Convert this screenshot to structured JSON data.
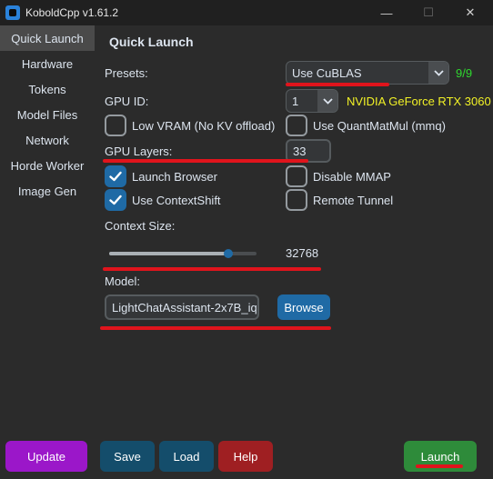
{
  "window": {
    "title": "KoboldCpp v1.61.2",
    "minimize": "—",
    "maximize": "☐",
    "close": "✕"
  },
  "sidebar": {
    "items": [
      {
        "label": "Quick Launch"
      },
      {
        "label": "Hardware"
      },
      {
        "label": "Tokens"
      },
      {
        "label": "Model Files"
      },
      {
        "label": "Network"
      },
      {
        "label": "Horde Worker"
      },
      {
        "label": "Image Gen"
      }
    ]
  },
  "main": {
    "title": "Quick Launch",
    "presets": {
      "label": "Presets:",
      "value": "Use CuBLAS",
      "count": "9/9"
    },
    "gpu_id": {
      "label": "GPU ID:",
      "value": "1",
      "gpu_name": "NVIDIA GeForce RTX 3060"
    },
    "options": {
      "low_vram": {
        "label": "Low VRAM (No KV offload)",
        "checked": false
      },
      "quantmatmul": {
        "label": "Use QuantMatMul (mmq)",
        "checked": false
      },
      "launch_browser": {
        "label": "Launch Browser",
        "checked": true
      },
      "disable_mmap": {
        "label": "Disable MMAP",
        "checked": false
      },
      "contextshift": {
        "label": "Use ContextShift",
        "checked": true
      },
      "remote_tunnel": {
        "label": "Remote Tunnel",
        "checked": false
      }
    },
    "gpu_layers": {
      "label": "GPU Layers:",
      "value": "33"
    },
    "context_size": {
      "label": "Context Size:",
      "value": "32768",
      "slider_fraction": 0.81
    },
    "model": {
      "label": "Model:",
      "value": "LightChatAssistant-2x7B_iq",
      "browse_label": "Browse"
    }
  },
  "footer": {
    "update_label": "Update",
    "save_label": "Save",
    "load_label": "Load",
    "help_label": "Help",
    "launch_label": "Launch"
  },
  "colors": {
    "accent_blue": "#1f6aa5",
    "preset_count_green": "#2fd82f",
    "gpu_name_yellow": "#f2f226",
    "update_purple": "#9b17c9",
    "save_load_teal": "#144d6b",
    "help_red": "#9f1f22",
    "launch_green": "#2e8b3a",
    "annotation_red": "#e0141c"
  }
}
